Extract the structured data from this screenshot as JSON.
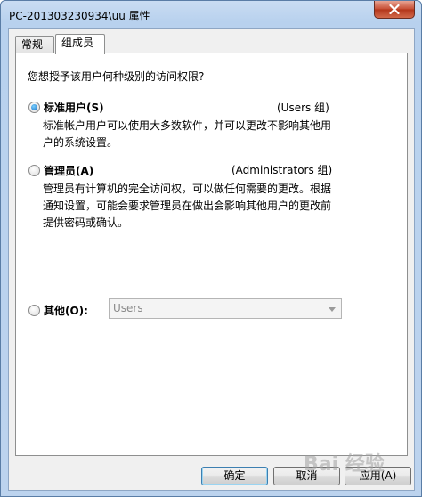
{
  "window": {
    "title": "PC-201303230934\\uu 属性"
  },
  "tabs": [
    {
      "label": "常规",
      "active": false
    },
    {
      "label": "组成员",
      "active": true
    }
  ],
  "panel": {
    "prompt": "您想授予该用户何种级别的访问权限?",
    "options": [
      {
        "label": "标准用户(S)",
        "group": "(Users 组)",
        "selected": true,
        "description": [
          "标准帐户用户可以使用大多数软件，并可以更改不影响其他用",
          "户的系统设置。"
        ]
      },
      {
        "label": "管理员(A)",
        "group": "(Administrators 组)",
        "selected": false,
        "description": [
          "管理员有计算机的完全访问权，可以做任何需要的更改。根据",
          "通知设置，可能会要求管理员在做出会影响其他用户的更改前",
          "提供密码或确认。"
        ]
      },
      {
        "label": "其他(O):",
        "selected": false,
        "dropdown_value": "Users"
      }
    ]
  },
  "buttons": {
    "ok": "确定",
    "cancel": "取消",
    "apply": "应用(A)"
  },
  "watermark": "Bai 经验",
  "colors": {
    "accent": "#1a6cc0",
    "close_button": "#c74f35"
  }
}
